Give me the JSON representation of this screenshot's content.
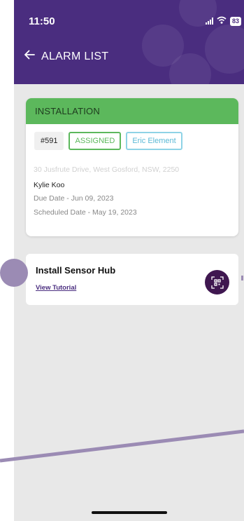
{
  "status_bar": {
    "time": "11:50",
    "battery": "83"
  },
  "header": {
    "title": "ALARM LIST"
  },
  "job_card": {
    "type": "INSTALLATION",
    "job_number": "#591",
    "status": "ASSIGNED",
    "technician": "Eric Element",
    "address": "30 Jusfrute Drive, West Gosford, NSW, 2250",
    "customer": "Kylie Koo",
    "due_date": "Due Date - Jun 09, 2023",
    "scheduled_date": "Scheduled Date - May 19, 2023"
  },
  "task_card": {
    "title": "Install Sensor Hub",
    "link": "View Tutorial"
  },
  "colors": {
    "header_purple": "#4a2d7f",
    "installation_green": "#5cb85c",
    "technician_blue": "#8ed3e6",
    "qr_button": "#3f1750",
    "tutorial_overlay": "#9b8bb4"
  },
  "icons": {
    "back": "arrow-left-icon",
    "signal": "signal-icon",
    "wifi": "wifi-icon",
    "battery": "battery-icon",
    "scan": "qr-scan-icon"
  }
}
